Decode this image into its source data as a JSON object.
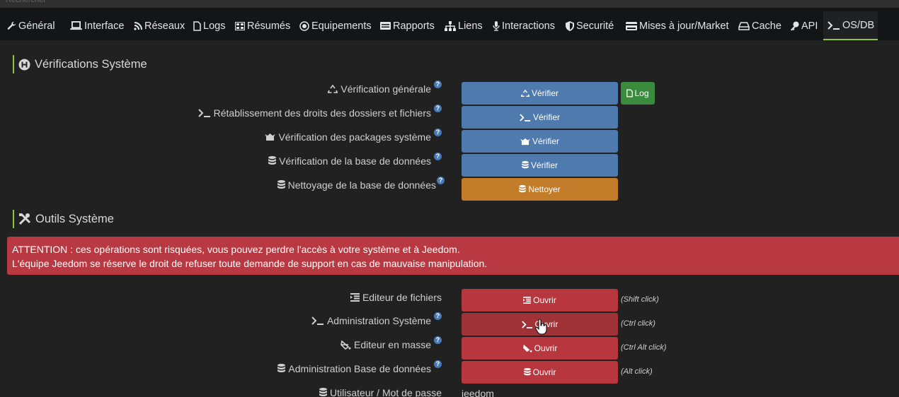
{
  "topbar": {
    "ghost_text": "Rechercher"
  },
  "tabs": [
    {
      "id": "general",
      "label": "Général",
      "icon": "wrench-icon"
    },
    {
      "id": "interface",
      "label": "Interface",
      "icon": "laptop-icon"
    },
    {
      "id": "reseaux",
      "label": "Réseaux",
      "icon": "rss-icon"
    },
    {
      "id": "logs",
      "label": "Logs",
      "icon": "file-icon"
    },
    {
      "id": "resumes",
      "label": "Résumés",
      "icon": "table-icon"
    },
    {
      "id": "equipements",
      "label": "Equipements",
      "icon": "equipment-icon"
    },
    {
      "id": "rapports",
      "label": "Rapports",
      "icon": "report-icon"
    },
    {
      "id": "liens",
      "label": "Liens",
      "icon": "sitemap-icon"
    },
    {
      "id": "interactions",
      "label": "Interactions",
      "icon": "microphone-icon"
    },
    {
      "id": "securite",
      "label": "Securité",
      "icon": "shield-icon"
    },
    {
      "id": "mises",
      "label": "Mises à jour/Market",
      "icon": "credit-card-icon"
    },
    {
      "id": "cache",
      "label": "Cache",
      "icon": "hdd-icon"
    },
    {
      "id": "api",
      "label": "API",
      "icon": "key-icon"
    },
    {
      "id": "osdb",
      "label": "OS/DB",
      "icon": "terminal-icon",
      "active": true
    }
  ],
  "section1": {
    "title": "Vérifications Système",
    "rows": [
      {
        "label": "Vérification générale",
        "icon": "recycle-icon",
        "help": true,
        "button": "Vérifier",
        "button_color": "blue"
      },
      {
        "label": "Rétablissement des droits des dossiers et fichiers",
        "icon": "terminal-icon",
        "help": true,
        "button": "Vérifier",
        "button_color": "blue"
      },
      {
        "label": "Vérification des packages système",
        "icon": "box-open-icon",
        "help": true,
        "button": "Vérifier",
        "button_color": "blue"
      },
      {
        "label": "Vérification de la base de données",
        "icon": "database-icon",
        "help": true,
        "button": "Vérifier",
        "button_color": "blue"
      },
      {
        "label": "Nettoyage de la base de données",
        "icon": "database-icon",
        "help": true,
        "button": "Nettoyer",
        "button_color": "orange"
      }
    ],
    "log_button": "Log"
  },
  "section2": {
    "title": "Outils Système",
    "alert_line1": "ATTENTION : ces opérations sont risquées, vous pouvez perdre l'accès à votre système et à Jeedom.",
    "alert_line2": "L'équipe Jeedom se réserve le droit de refuser toute demande de support en cas de mauvaise manipulation.",
    "rows": [
      {
        "label": "Editeur de fichiers",
        "icon": "indent-icon",
        "help": false,
        "button": "Ouvrir",
        "hint": "(Shift click)"
      },
      {
        "label": "Administration Système",
        "icon": "terminal-icon",
        "help": true,
        "button": "Ouvrir",
        "hint": "(Ctrl click)"
      },
      {
        "label": "Editeur en masse",
        "icon": "fill-drip-icon",
        "help": true,
        "button": "Ouvrir",
        "hint": "(Ctrl Alt click)"
      },
      {
        "label": "Administration Base de données",
        "icon": "database-icon",
        "help": true,
        "button": "Ouvrir",
        "hint": "(Alt click)"
      }
    ],
    "user_row": {
      "label": "Utilisateur / Mot de passe",
      "icon": "database-icon",
      "value": "jeedom"
    }
  },
  "colors": {
    "accent": "#8cc63f",
    "blue": "#4e7aae",
    "orange": "#c27c2a",
    "red": "#b8373e",
    "green": "#3a8b3e"
  }
}
